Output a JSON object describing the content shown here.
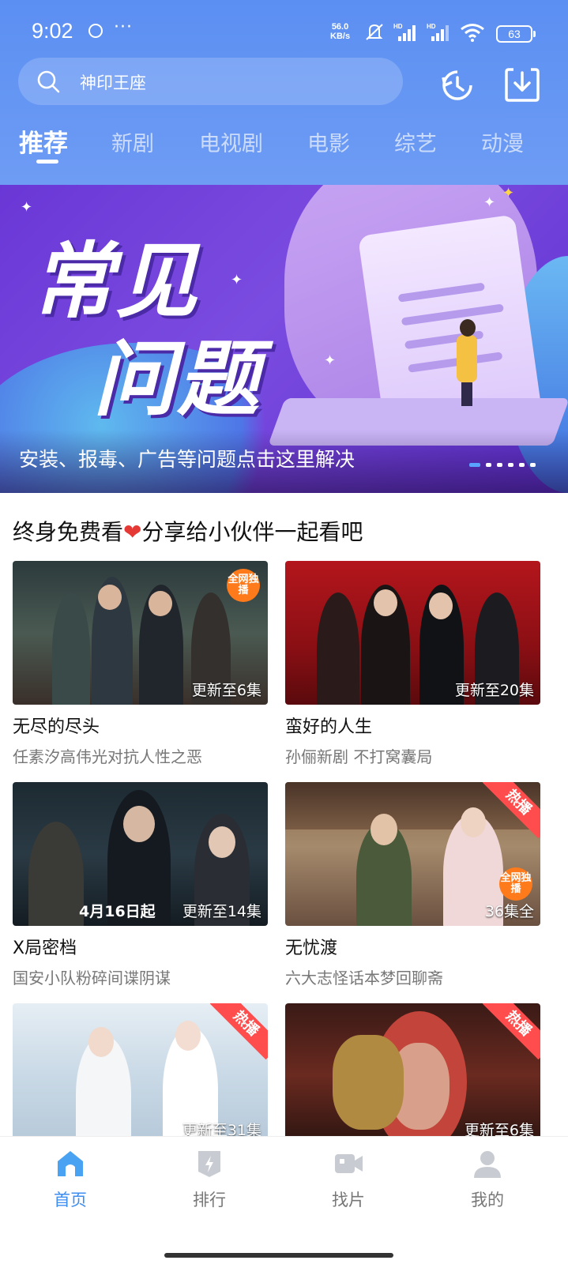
{
  "status_bar": {
    "time": "9:02",
    "more": "···",
    "speed_value": "56.0",
    "speed_unit": "KB/s",
    "battery": "63",
    "icons": [
      "vpn-icon",
      "mute-icon",
      "signal-hd-icon",
      "signal-hd-icon",
      "wifi-icon"
    ]
  },
  "header": {
    "search_placeholder": "神印王座",
    "tabs": [
      {
        "label": "推荐",
        "active": true
      },
      {
        "label": "新剧"
      },
      {
        "label": "电视剧"
      },
      {
        "label": "电影"
      },
      {
        "label": "综艺"
      },
      {
        "label": "动漫"
      }
    ],
    "accent": "#5b8ff2"
  },
  "banner": {
    "title_line1": "常见",
    "title_line2": "问题",
    "caption": "安装、报毒、广告等问题点击这里解决",
    "page_count": 6,
    "active_page": 0
  },
  "section": {
    "title": "终身免费看",
    "heart": "❤",
    "title_suffix": "分享给小伙伴一起看吧"
  },
  "cards": [
    {
      "title": "无尽的尽头",
      "subtitle": "任素汐高伟光对抗人性之恶",
      "episodes": "更新至6集",
      "badge": "全网独播"
    },
    {
      "title": "蛮好的人生",
      "subtitle": "孙俪新剧 不打窝囊局",
      "episodes": "更新至20集"
    },
    {
      "title": "X局密档",
      "subtitle": "国安小队粉碎间谍阴谋",
      "episodes": "更新至14集",
      "poster_text": "4月16日起"
    },
    {
      "title": "无忧渡",
      "subtitle": "六大志怪话本梦回聊斋",
      "episodes": "36集全",
      "hot": "热播",
      "badge": "全网独播"
    },
    {
      "episodes": "更新至31集",
      "hot": "热播"
    },
    {
      "episodes": "更新至6集",
      "hot": "热播"
    }
  ],
  "nav": {
    "items": [
      {
        "label": "首页",
        "active": true
      },
      {
        "label": "排行"
      },
      {
        "label": "找片"
      },
      {
        "label": "我的"
      }
    ],
    "active_color": "#3d8ef0"
  }
}
